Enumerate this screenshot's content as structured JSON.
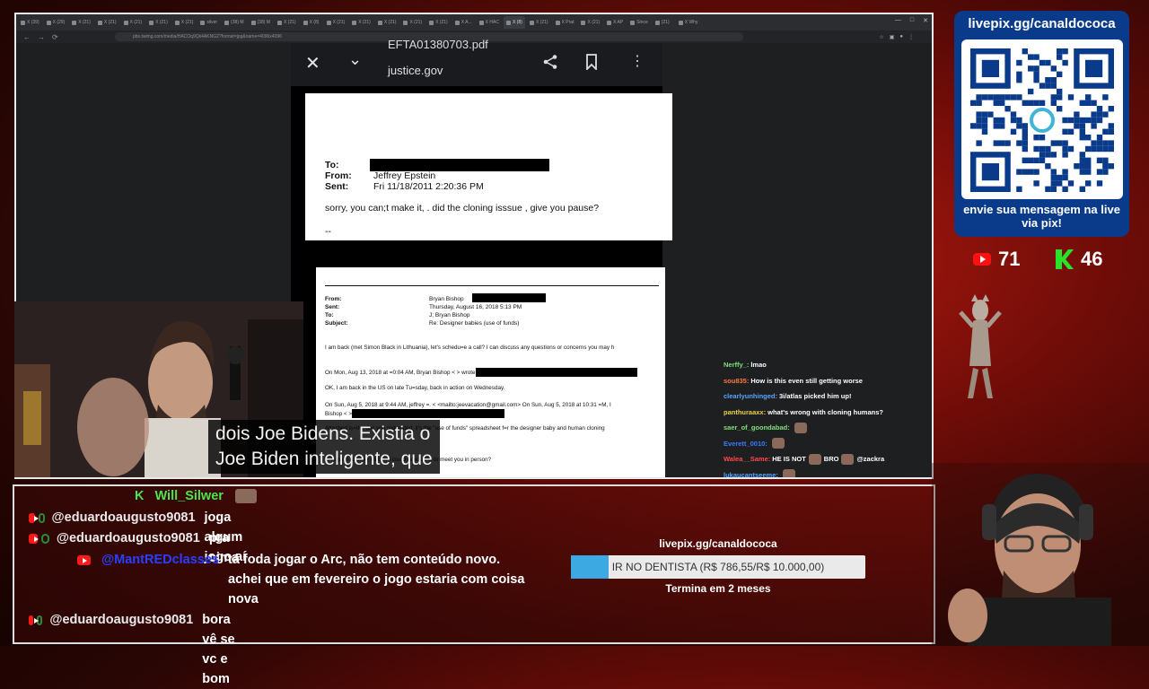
{
  "browser": {
    "tabs": [
      "X (39)",
      "X (29)",
      "X (21)",
      "X (21)",
      "X (21)",
      "X (21)",
      "X (21)",
      "silver",
      "(38) M",
      "(38) M",
      "X (21)",
      "X (8)",
      "X (21)",
      "X (21)",
      "X (21)",
      "X (21)",
      "X (21)",
      "X A...",
      "X HAC",
      "X (8)",
      "X (21)",
      "X Prat",
      "X (21)",
      "X AP",
      "Since",
      "(21)",
      "X Why"
    ],
    "url": "pbs.twimg.com/media/HACOq9Qk4AKNG2?format=jpg&name=4096x4096"
  },
  "phone": {
    "filename": "EFTA01380703.pdf",
    "domain": "justice.gov"
  },
  "doc1": {
    "to_label": "To:",
    "from_label": "From:",
    "from_value": "Jeffrey Epstein",
    "sent_label": "Sent:",
    "sent_value": "Fri 11/18/2011 2:20:36 PM",
    "body": "sorry, you can;t make it,  .  did the cloning isssue  , give you pause?",
    "sig": "--"
  },
  "doc2": {
    "from_label": "From:",
    "from_value": "Bryan Bishop",
    "sent_label": "Sent:",
    "sent_value": "Thursday, August 16, 2018 5:13 PM",
    "to_label": "To:",
    "to_value": "J; Bryan Bishop",
    "subject_label": "Subject:",
    "subject_value": "Re: Designer babies (use of funds)",
    "lines": [
      "I am back (met Simon Black in Lithuania), let's schedu=e a call? I can discuss any questions or concerns you may h",
      "On Mon, Aug 13, 2018 at =0:04 AM, Bryan Bishop <                                    > wrote:",
      "OK, I am back in the US on late Tu=sday, back in action on Wednesday.",
      "On Sun, Aug 5, 2018 at 9:44 AM, jeffrey =. < <mailto:jeevacation@gmail.com> On Sun, Aug 5, 2018 at 10:31 =M, I",
      "Bishop <                                    > wrote:",
      "Attached is=the doc you requested, it's the \"use of funds\" spreadsheet f=r the designer baby and human cloning",
      "                                    to hop on another call, or I could take a trip to meet you in person?"
    ]
  },
  "subtitle": {
    "line1": "dois Joe Bidens.  Existia o",
    "line2": "Joe Biden inteligente, que"
  },
  "small_chat": [
    {
      "user": "Nerffy_:",
      "msg": "lmao",
      "color": "#7fe07a"
    },
    {
      "user": "sou835:",
      "msg": "How is this even still getting worse",
      "color": "#ff7a3a"
    },
    {
      "user": "clearlyunhinged:",
      "msg": "3i/atlas picked him up!",
      "color": "#58a6ff"
    },
    {
      "user": "panthuraaxx:",
      "msg": "what's wrong with cloning humans?",
      "color": "#e8d24a"
    },
    {
      "user": "saer_of_goondabad:",
      "msg": "",
      "color": "#7fe07a"
    },
    {
      "user": "Everett_0010:",
      "msg": "",
      "color": "#3a7bff"
    },
    {
      "user": "Walea__Same:",
      "msg": "HE IS NOT",
      "msg2": "BRO",
      "msg3": "@zackra",
      "color": "#ff4a4a"
    },
    {
      "user": "lukaucantseeme:",
      "msg": "",
      "color": "#58a6ff"
    }
  ],
  "qr": {
    "url": "livepix.gg/canaldococa",
    "caption": "envie sua mensagem na live via pix!"
  },
  "stats": {
    "youtube": "71",
    "kick": "46"
  },
  "big_chat": [
    {
      "platform": "kick",
      "user": "Will_Silwer",
      "msg": "",
      "user_color": "#4ce64c"
    },
    {
      "platform": "youtube",
      "user": "@eduardoaugusto9081",
      "msg": "joga algum jogo aí",
      "user_color": "#e9e9e9"
    },
    {
      "platform": "youtube",
      "user": "@eduardoaugusto9081",
      "msg": "pra cima",
      "user_color": "#e9e9e9"
    },
    {
      "platform": "youtube",
      "user": "@MantREDclasses",
      "msg": "tá foda jogar o Arc, não tem conteúdo novo. achei que em fevereiro o jogo estaria com coisa nova",
      "user_color": "#2a3fff"
    },
    {
      "platform": "youtube",
      "user": "@eduardoaugusto9081",
      "msg": "bora vê se vc e bom",
      "user_color": "#e9e9e9"
    }
  ],
  "goal": {
    "site": "livepix.gg/canaldococa",
    "label": "IR NO DENTISTA (R$ 786,55/R$ 10.000,00)",
    "progress": 0.0787,
    "ends": "Termina em 2 meses"
  }
}
